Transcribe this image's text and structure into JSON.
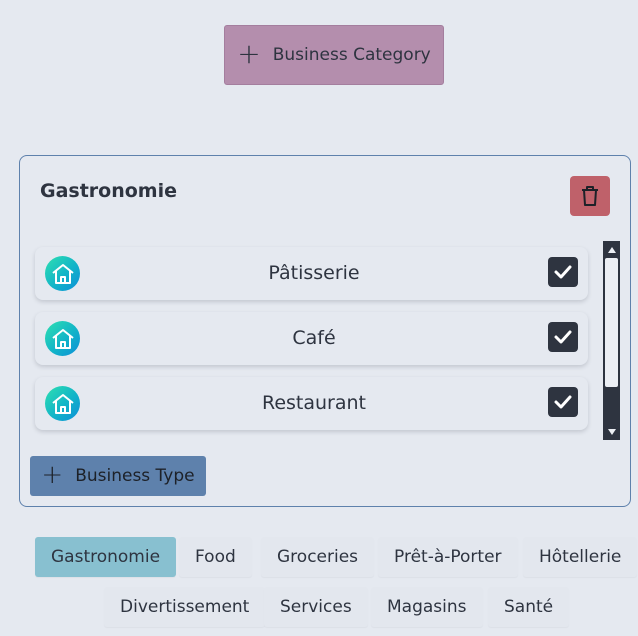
{
  "top_button": {
    "label": "Business Category"
  },
  "category": {
    "title": "Gastronomie",
    "types": [
      {
        "label": "Pâtisserie",
        "checked": true
      },
      {
        "label": "Café",
        "checked": true
      },
      {
        "label": "Restaurant",
        "checked": true
      }
    ],
    "add_type_label": "Business Type"
  },
  "tags": [
    {
      "label": "Gastronomie",
      "active": true
    },
    {
      "label": "Food",
      "active": false
    },
    {
      "label": "Groceries",
      "active": false
    },
    {
      "label": "Prêt-à-Porter",
      "active": false
    },
    {
      "label": "Hôtellerie",
      "active": false
    },
    {
      "label": "Divertissement",
      "active": false
    },
    {
      "label": "Services",
      "active": false
    },
    {
      "label": "Magasins",
      "active": false
    },
    {
      "label": "Santé",
      "active": false
    }
  ],
  "icons": {
    "add": "plus-icon",
    "delete": "trash-icon",
    "type": "home-icon",
    "checked": "check-icon"
  },
  "colors": {
    "background": "#e5e9f0",
    "category_button": "#b48ead",
    "type_button": "#5e81ac",
    "delete_button": "#bf616a",
    "active_tag": "#88c0d0",
    "checkbox": "#2e3440",
    "card_border": "#5e81ac"
  }
}
